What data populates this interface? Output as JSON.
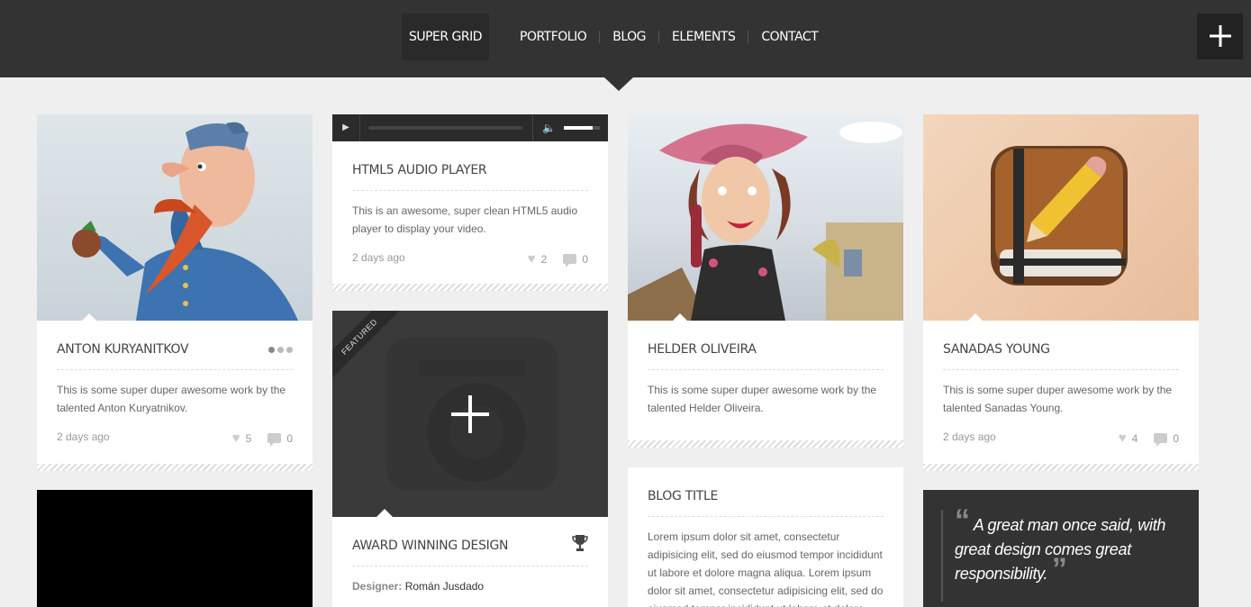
{
  "header": {
    "logo": "SUPER GRID",
    "nav": [
      "PORTFOLIO",
      "BLOG",
      "ELEMENTS",
      "CONTACT"
    ],
    "plus_icon": "plus-icon"
  },
  "cards": {
    "anton": {
      "title": "ANTON KURYANITKOV",
      "desc": "This is some super duper awesome work by the talented Anton Kuryatnikov.",
      "date": "2 days ago",
      "likes": "5",
      "comments": "0"
    },
    "audio": {
      "title": "HTML5 AUDIO PLAYER",
      "desc": "This is an awesome, super clean HTML5 audio player to display your video.",
      "date": "2 days ago",
      "likes": "2",
      "comments": "0",
      "volume": 0.8
    },
    "featured": {
      "ribbon": "FEATURED",
      "title": "AWARD WINNING DESIGN",
      "designer_label": "Designer:",
      "designer": "Román Jusdado"
    },
    "helder": {
      "title": "HELDER OLIVEIRA",
      "desc": "This is some super duper awesome work by the talented Helder Oliveira."
    },
    "blog": {
      "title": "BLOG TITLE",
      "desc": "Lorem ipsum dolor sit amet, consectetur adipisicing elit, sed do eiusmod tempor incididunt ut labore et dolore magna aliqua. Lorem ipsum dolor sit amet, consectetur adipisicing elit, sed do eiusmod tempor incididunt ut labore et dolore"
    },
    "sanadas": {
      "title": "SANADAS YOUNG",
      "desc": "This is some super duper awesome work by the talented Sanadas Young.",
      "date": "2 days ago",
      "likes": "4",
      "comments": "0"
    },
    "quote": {
      "open": "“",
      "text": "A great man once said, with great design comes great responsibility.",
      "close": "”"
    }
  },
  "colors": {
    "header_bg": "#333333",
    "page_bg": "#efefef"
  }
}
